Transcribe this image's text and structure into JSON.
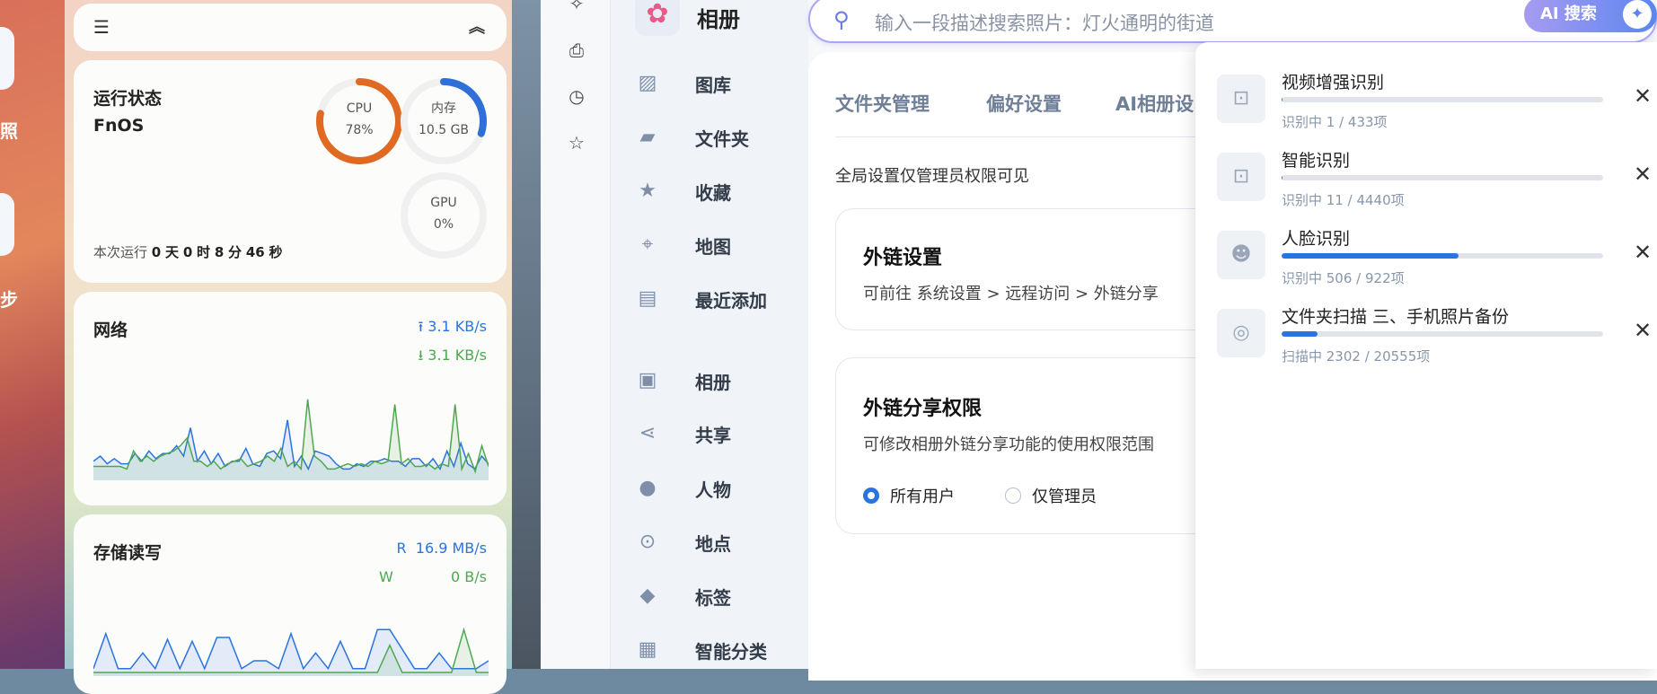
{
  "desktop": {
    "labels": [
      "照",
      "步"
    ]
  },
  "widget": {
    "status": {
      "title": "运行状态",
      "os": "FnOS",
      "cpu_label": "CPU",
      "cpu_value": "78%",
      "cpu_pct": 78,
      "mem_label": "内存",
      "mem_value": "10.5 GB",
      "mem_pct": 30,
      "gpu_label": "GPU",
      "gpu_value": "0%",
      "gpu_pct": 0,
      "uptime_prefix": "本次运行",
      "uptime": [
        "0",
        "天",
        "0",
        "时",
        "8",
        "分",
        "46",
        "秒"
      ]
    },
    "network": {
      "title": "网络",
      "up": "3.1 KB/s",
      "down": "3.1 KB/s",
      "up_series": [
        6,
        8,
        5,
        7,
        5,
        5,
        9,
        6,
        10,
        7,
        9,
        9,
        12,
        8,
        19,
        6,
        10,
        5,
        9,
        4,
        6,
        6,
        11,
        5,
        4,
        9,
        10,
        7,
        22,
        4,
        8,
        3,
        10,
        9,
        8,
        5,
        3,
        3,
        5,
        4,
        6,
        6,
        7,
        6,
        6,
        4,
        7,
        7,
        4,
        7,
        3,
        10,
        4,
        13,
        5,
        3,
        8,
        5
      ],
      "down_series": [
        4,
        4,
        4,
        4,
        4,
        3,
        10,
        6,
        8,
        6,
        8,
        9,
        10,
        12,
        15,
        6,
        6,
        4,
        6,
        3,
        5,
        6,
        7,
        4,
        5,
        6,
        8,
        6,
        11,
        4,
        6,
        3,
        30,
        8,
        6,
        3,
        3,
        4,
        5,
        4,
        5,
        4,
        6,
        5,
        6,
        28,
        5,
        7,
        4,
        4,
        5,
        3,
        5,
        4,
        28,
        3,
        9,
        2,
        12,
        4
      ]
    },
    "storage": {
      "title": "存储读写",
      "r_label": "R",
      "r_value": "16.9 MB/s",
      "w_label": "W",
      "w_value": "0 B/s",
      "r_series": [
        2,
        20,
        2,
        2,
        10,
        2,
        17,
        2,
        16,
        2,
        18,
        18,
        2,
        6,
        6,
        2,
        20,
        2,
        10,
        2,
        16,
        2,
        2,
        22,
        22,
        12,
        2,
        2,
        10,
        2,
        2,
        2,
        6
      ],
      "w_series": [
        0,
        0,
        0,
        0,
        0,
        0,
        0,
        0,
        0,
        0,
        0,
        0,
        0,
        0,
        0,
        0,
        0,
        0,
        0,
        0,
        0,
        0,
        0,
        0,
        14,
        0,
        0,
        0,
        0,
        0,
        22,
        0,
        0
      ]
    }
  },
  "app": {
    "title": "相册",
    "search_placeholder": "输入一段描述搜索照片：灯火通明的街道",
    "ai_search": "AI 搜索",
    "nav": [
      "图库",
      "文件夹",
      "收藏",
      "地图",
      "最近添加",
      "相册",
      "共享",
      "人物",
      "地点",
      "标签",
      "智能分类"
    ],
    "tabs": [
      "文件夹管理",
      "偏好设置",
      "AI相册设"
    ],
    "notice": "全局设置仅管理员权限可见",
    "link_settings": {
      "title": "外链设置",
      "desc": "可前往 系统设置 > 远程访问 > 外链分享"
    },
    "share_perm": {
      "title": "外链分享权限",
      "desc": "可修改相册外链分享功能的使用权限范围",
      "options": [
        "所有用户",
        "仅管理员"
      ],
      "selected": 0
    }
  },
  "tasks": [
    {
      "name": "视频增强识别",
      "status": "识别中 1 / 433项",
      "progress": 0.2
    },
    {
      "name": "智能识别",
      "status": "识别中 11 / 4440项",
      "progress": 0.2
    },
    {
      "name": "人脸识别",
      "status": "识别中 506 / 922项",
      "progress": 54.9
    },
    {
      "name": "文件夹扫描 三、手机照片备份",
      "status": "扫描中 2302 / 20555项",
      "progress": 11.2
    }
  ],
  "colors": {
    "accent": "#2a74e0",
    "cpu": "#e06a22",
    "green": "#4fa84f"
  }
}
